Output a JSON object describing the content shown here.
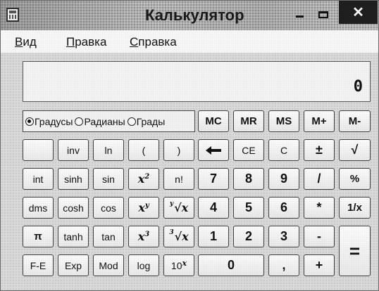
{
  "window": {
    "title": "Калькулятор",
    "close_glyph": "✕"
  },
  "menu": [
    "Вид",
    "Правка",
    "Справка"
  ],
  "display": {
    "value": "0"
  },
  "angle_units": {
    "options": [
      "Градусы",
      "Радианы",
      "Грады"
    ],
    "selected": "Градусы"
  },
  "memory_buttons": [
    "MC",
    "MR",
    "MS",
    "M+",
    "M-"
  ],
  "buttons": {
    "blank": "",
    "inv": "inv",
    "ln": "ln",
    "open_paren": "(",
    "close_paren": ")",
    "backspace": "",
    "ce": "CE",
    "c": "C",
    "plus_minus": "±",
    "sqrt": "√",
    "int": "int",
    "sinh": "sinh",
    "sin": "sin",
    "x_squared_base": "x",
    "x_squared_exp": "2",
    "factorial": "n!",
    "d7": "7",
    "d8": "8",
    "d9": "9",
    "divide": "/",
    "percent": "%",
    "dms": "dms",
    "cosh": "cosh",
    "cos": "cos",
    "x_pow_y_base": "x",
    "x_pow_y_exp": "y",
    "y_root_x_index": "y",
    "y_root_x_body": "√x",
    "d4": "4",
    "d5": "5",
    "d6": "6",
    "multiply": "*",
    "reciprocal": "1/x",
    "pi": "π",
    "tanh": "tanh",
    "tan": "tan",
    "x_cubed_base": "x",
    "x_cubed_exp": "3",
    "cube_root_index": "3",
    "cube_root_body": "√x",
    "d1": "1",
    "d2": "2",
    "d3": "3",
    "minus": "-",
    "equals": "=",
    "fe": "F-E",
    "exp": "Exp",
    "mod": "Mod",
    "log": "log",
    "ten_pow_base": "10",
    "ten_pow_exp": "x",
    "d0": "0",
    "decimal": ",",
    "plus": "+"
  }
}
